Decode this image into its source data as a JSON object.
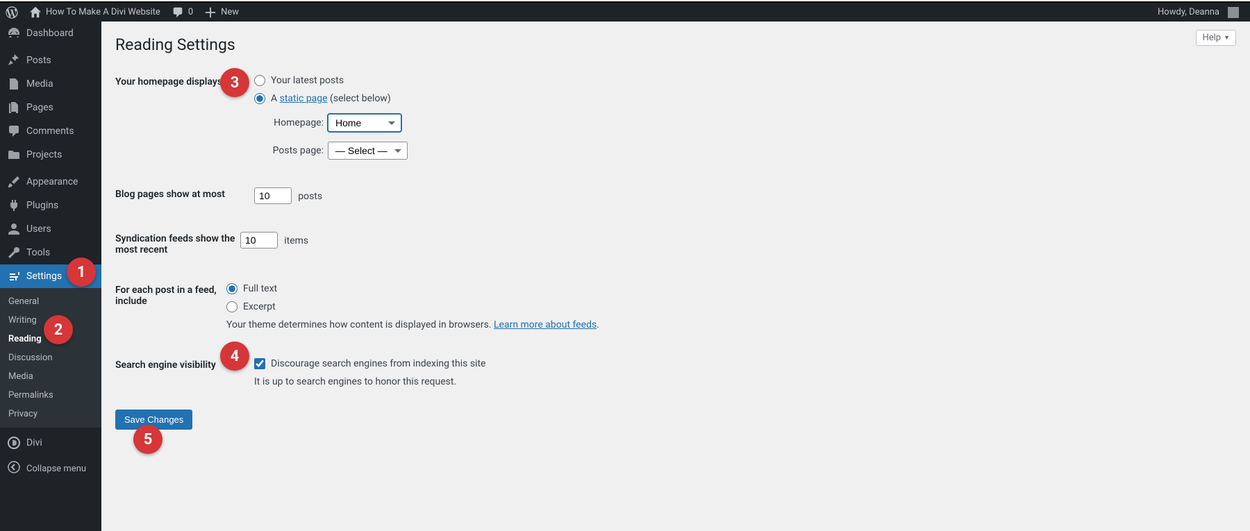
{
  "toolbar": {
    "site_title": "How To Make A Divi Website",
    "comment_count": "0",
    "new_label": "New",
    "howdy": "Howdy, Deanna"
  },
  "help_label": "Help",
  "page_title": "Reading Settings",
  "sidebar": {
    "items": [
      {
        "label": "Dashboard"
      },
      {
        "label": "Posts"
      },
      {
        "label": "Media"
      },
      {
        "label": "Pages"
      },
      {
        "label": "Comments"
      },
      {
        "label": "Projects"
      },
      {
        "label": "Appearance"
      },
      {
        "label": "Plugins"
      },
      {
        "label": "Users"
      },
      {
        "label": "Tools"
      },
      {
        "label": "Settings"
      },
      {
        "label": "Divi"
      }
    ],
    "submenu": [
      {
        "label": "General"
      },
      {
        "label": "Writing"
      },
      {
        "label": "Reading"
      },
      {
        "label": "Discussion"
      },
      {
        "label": "Media"
      },
      {
        "label": "Permalinks"
      },
      {
        "label": "Privacy"
      }
    ],
    "collapse": "Collapse menu"
  },
  "form": {
    "hp_label": "Your homepage displays",
    "hp_opt1": "Your latest posts",
    "hp_opt2_prefix": "A ",
    "hp_opt2_link": "static page",
    "hp_opt2_suffix": " (select below)",
    "homepage_label": "Homepage:",
    "homepage_sel": "Home",
    "postspage_label": "Posts page:",
    "postspage_sel": "— Select —",
    "blog_pages_label": "Blog pages show at most",
    "blog_pages_val": "10",
    "blog_pages_unit": "posts",
    "synd_label": "Syndication feeds show the most recent",
    "synd_val": "10",
    "synd_unit": "items",
    "feed_label": "For each post in a feed, include",
    "feed_opt1": "Full text",
    "feed_opt2": "Excerpt",
    "feed_desc_pre": "Your theme determines how content is displayed in browsers. ",
    "feed_desc_link": "Learn more about feeds",
    "sev_label": "Search engine visibility",
    "sev_check": "Discourage search engines from indexing this site",
    "sev_desc": "It is up to search engines to honor this request.",
    "save": "Save Changes"
  },
  "callouts": {
    "c1": "1",
    "c2": "2",
    "c3": "3",
    "c4": "4",
    "c5": "5"
  }
}
